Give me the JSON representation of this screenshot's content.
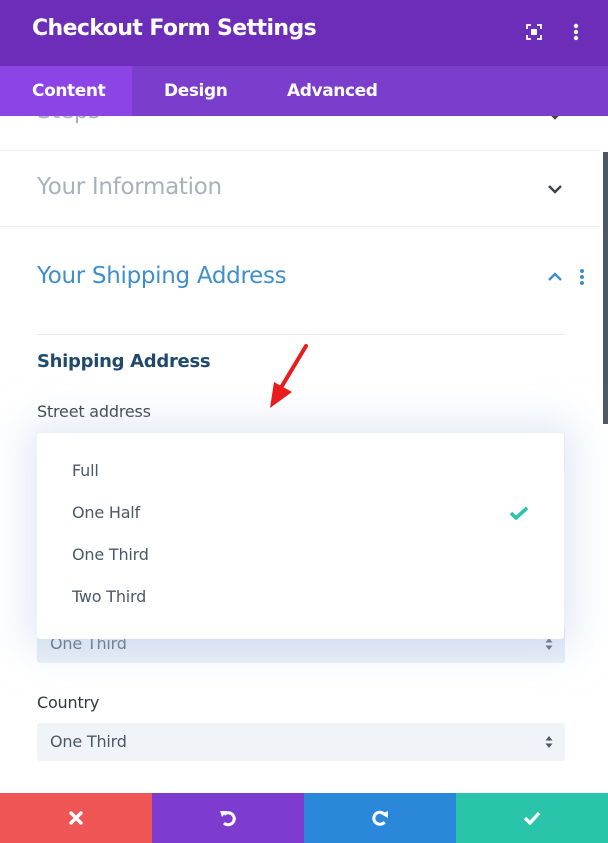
{
  "header": {
    "title": "Checkout Form Settings",
    "icons": [
      "expand-icon",
      "more-vertical-icon"
    ]
  },
  "tabs": [
    {
      "label": "Content",
      "active": true
    },
    {
      "label": "Design",
      "active": false
    },
    {
      "label": "Advanced",
      "active": false
    }
  ],
  "sections": [
    {
      "title": "Steps",
      "state": "collapsed"
    },
    {
      "title": "Your Information",
      "state": "collapsed"
    },
    {
      "title": "Your Shipping Address",
      "state": "expanded"
    }
  ],
  "shipping": {
    "group_title": "Shipping Address",
    "fields": [
      {
        "label": "Street address",
        "value": "One Half"
      },
      {
        "label": "",
        "value": "One Third"
      },
      {
        "label": "Country",
        "value": "One Third"
      }
    ]
  },
  "dropdown": {
    "options": [
      {
        "label": "Full",
        "selected": false
      },
      {
        "label": "One Half",
        "selected": true
      },
      {
        "label": "One Third",
        "selected": false
      },
      {
        "label": "Two Third",
        "selected": false
      }
    ]
  },
  "footer": {
    "buttons": [
      {
        "name": "discard",
        "icon": "close-icon",
        "color": "#ef5555"
      },
      {
        "name": "undo",
        "icon": "undo-icon",
        "color": "#7e3bd0"
      },
      {
        "name": "redo",
        "icon": "redo-icon",
        "color": "#2b87da"
      },
      {
        "name": "save",
        "icon": "check-icon",
        "color": "#29c4a9"
      }
    ]
  },
  "colors": {
    "header_bg": "#6c2eb9",
    "tabs_bg": "#7b3dcc",
    "active_tab_bg": "#8d44e6",
    "open_section_title": "#3e8fcb",
    "collapsed_section_title": "#a9b1bd",
    "check_color": "#29c4a9",
    "annotation_arrow": "#e81c1c"
  }
}
